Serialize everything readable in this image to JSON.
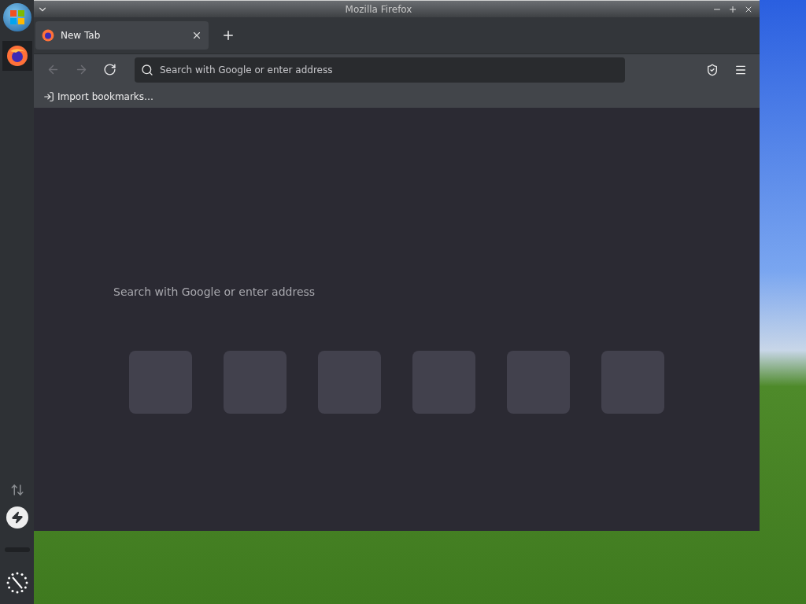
{
  "window": {
    "title": "Mozilla Firefox"
  },
  "tabs": [
    {
      "label": "New Tab",
      "selected": true
    }
  ],
  "nav_buttons": [
    {
      "kind": "back",
      "disabled": true
    },
    {
      "kind": "forward",
      "disabled": true
    },
    {
      "kind": "reload",
      "disabled": false
    }
  ],
  "address_bar": {
    "placeholder": "Search with Google or enter address"
  },
  "bookmarks_bar": {
    "items": [
      {
        "label": "Import bookmarks…"
      }
    ]
  },
  "new_tab_page": {
    "search_placeholder": "Search with Google or enter address"
  }
}
